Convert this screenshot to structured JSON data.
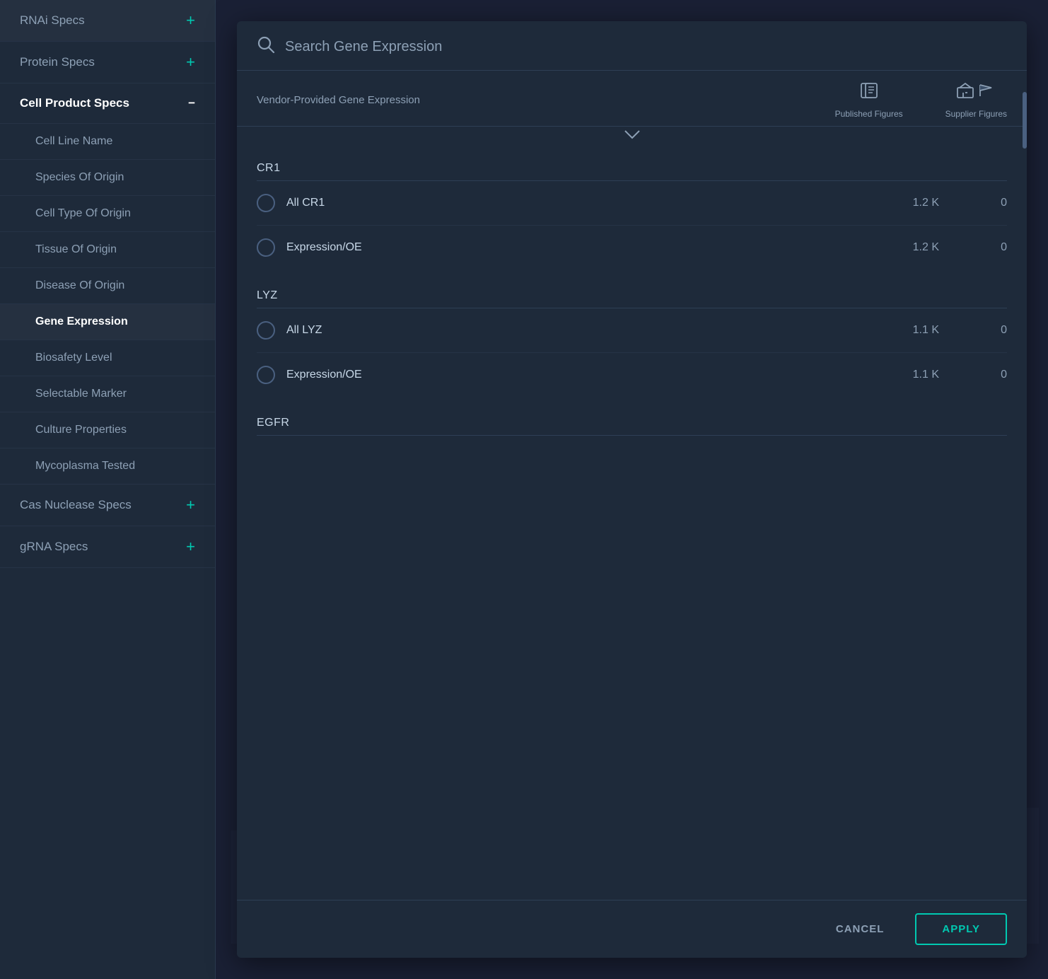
{
  "sidebar": {
    "items": [
      {
        "id": "rnai-specs",
        "label": "RNAi Specs",
        "icon": "plus",
        "type": "expandable"
      },
      {
        "id": "protein-specs",
        "label": "Protein Specs",
        "icon": "plus",
        "type": "expandable"
      },
      {
        "id": "cell-product-specs",
        "label": "Cell Product Specs",
        "icon": "minus",
        "type": "expanded"
      },
      {
        "id": "cell-line-name",
        "label": "Cell Line Name",
        "type": "child"
      },
      {
        "id": "species-of-origin",
        "label": "Species Of Origin",
        "type": "child"
      },
      {
        "id": "cell-type-of-origin",
        "label": "Cell Type Of Origin",
        "type": "child"
      },
      {
        "id": "tissue-of-origin",
        "label": "Tissue Of Origin",
        "type": "child"
      },
      {
        "id": "disease-of-origin",
        "label": "Disease Of Origin",
        "type": "child"
      },
      {
        "id": "gene-expression",
        "label": "Gene Expression",
        "type": "child",
        "active": true
      },
      {
        "id": "biosafety-level",
        "label": "Biosafety Level",
        "type": "child"
      },
      {
        "id": "selectable-marker",
        "label": "Selectable Marker",
        "type": "child"
      },
      {
        "id": "culture-properties",
        "label": "Culture Properties",
        "type": "child"
      },
      {
        "id": "mycoplasma-tested",
        "label": "Mycoplasma Tested",
        "type": "child"
      },
      {
        "id": "cas-nuclease-specs",
        "label": "Cas Nuclease Specs",
        "icon": "plus",
        "type": "expandable"
      },
      {
        "id": "grna-specs",
        "label": "gRNA Specs",
        "icon": "plus",
        "type": "expandable"
      }
    ]
  },
  "dialog": {
    "search": {
      "placeholder": "Search Gene Expression"
    },
    "vendor_label": "Vendor-Provided Gene Expression",
    "columns": {
      "published_figures": "Published Figures",
      "supplier_figures": "Supplier Figures"
    },
    "gene_groups": [
      {
        "id": "CR1",
        "label": "CR1",
        "rows": [
          {
            "id": "all-cr1",
            "label": "All CR1",
            "published": "1.2 K",
            "supplier": "0"
          },
          {
            "id": "expr-cr1",
            "label": "Expression/OE",
            "published": "1.2 K",
            "supplier": "0"
          }
        ]
      },
      {
        "id": "LYZ",
        "label": "LYZ",
        "rows": [
          {
            "id": "all-lyz",
            "label": "All LYZ",
            "published": "1.1 K",
            "supplier": "0"
          },
          {
            "id": "expr-lyz",
            "label": "Expression/OE",
            "published": "1.1 K",
            "supplier": "0"
          }
        ]
      },
      {
        "id": "EGFR",
        "label": "EGFR",
        "rows": []
      }
    ],
    "footer": {
      "cancel_label": "CANCEL",
      "apply_label": "APPLY"
    }
  }
}
